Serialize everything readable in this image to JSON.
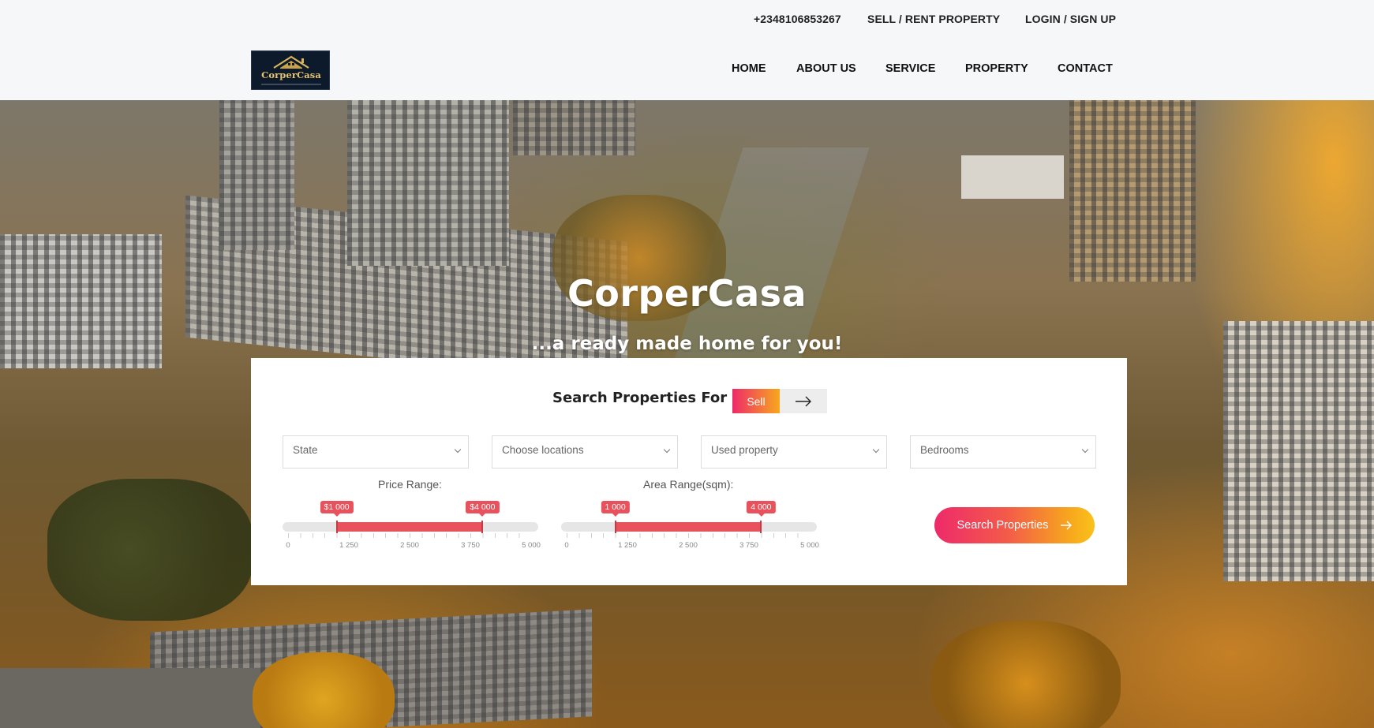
{
  "topbar": {
    "phone": "+2348106853267",
    "sell_rent": "SELL / RENT PROPERTY",
    "login": "LOGIN / SIGN UP"
  },
  "brand": {
    "logo_text": "CorperCasa"
  },
  "nav": {
    "home": "HOME",
    "about": "ABOUT US",
    "service": "SERVICE",
    "property": "PROPERTY",
    "contact": "CONTACT"
  },
  "hero": {
    "title": "CorperCasa",
    "subtitle": "...a ready made home for you!"
  },
  "search": {
    "heading": "Search Properties For",
    "mode_selected": "Sell",
    "filters": {
      "state": "State",
      "location": "Choose locations",
      "condition": "Used property",
      "bedrooms": "Bedrooms"
    },
    "price": {
      "label": "Price Range:",
      "min": 0,
      "max": 5000,
      "low": 1000,
      "high": 4000,
      "low_label": "$1 000",
      "high_label": "$4 000",
      "ticks": [
        "0",
        "1 250",
        "2 500",
        "3 750",
        "5 000"
      ]
    },
    "area": {
      "label": "Area Range(sqm):",
      "min": 0,
      "max": 5000,
      "low": 1000,
      "high": 4000,
      "low_label": "1 000",
      "high_label": "4 000",
      "ticks": [
        "0",
        "1 250",
        "2 500",
        "3 750",
        "5 000"
      ]
    },
    "button_label": "Search Properties"
  },
  "colors": {
    "accent": "#e8525d",
    "gradient_start": "#ee2a6a",
    "gradient_end": "#f7a81d"
  },
  "icons": {
    "toggle_arrow": "arrow-right-icon",
    "button_arrow": "arrow-right-icon",
    "select_chevron": "chevron-down-icon"
  }
}
